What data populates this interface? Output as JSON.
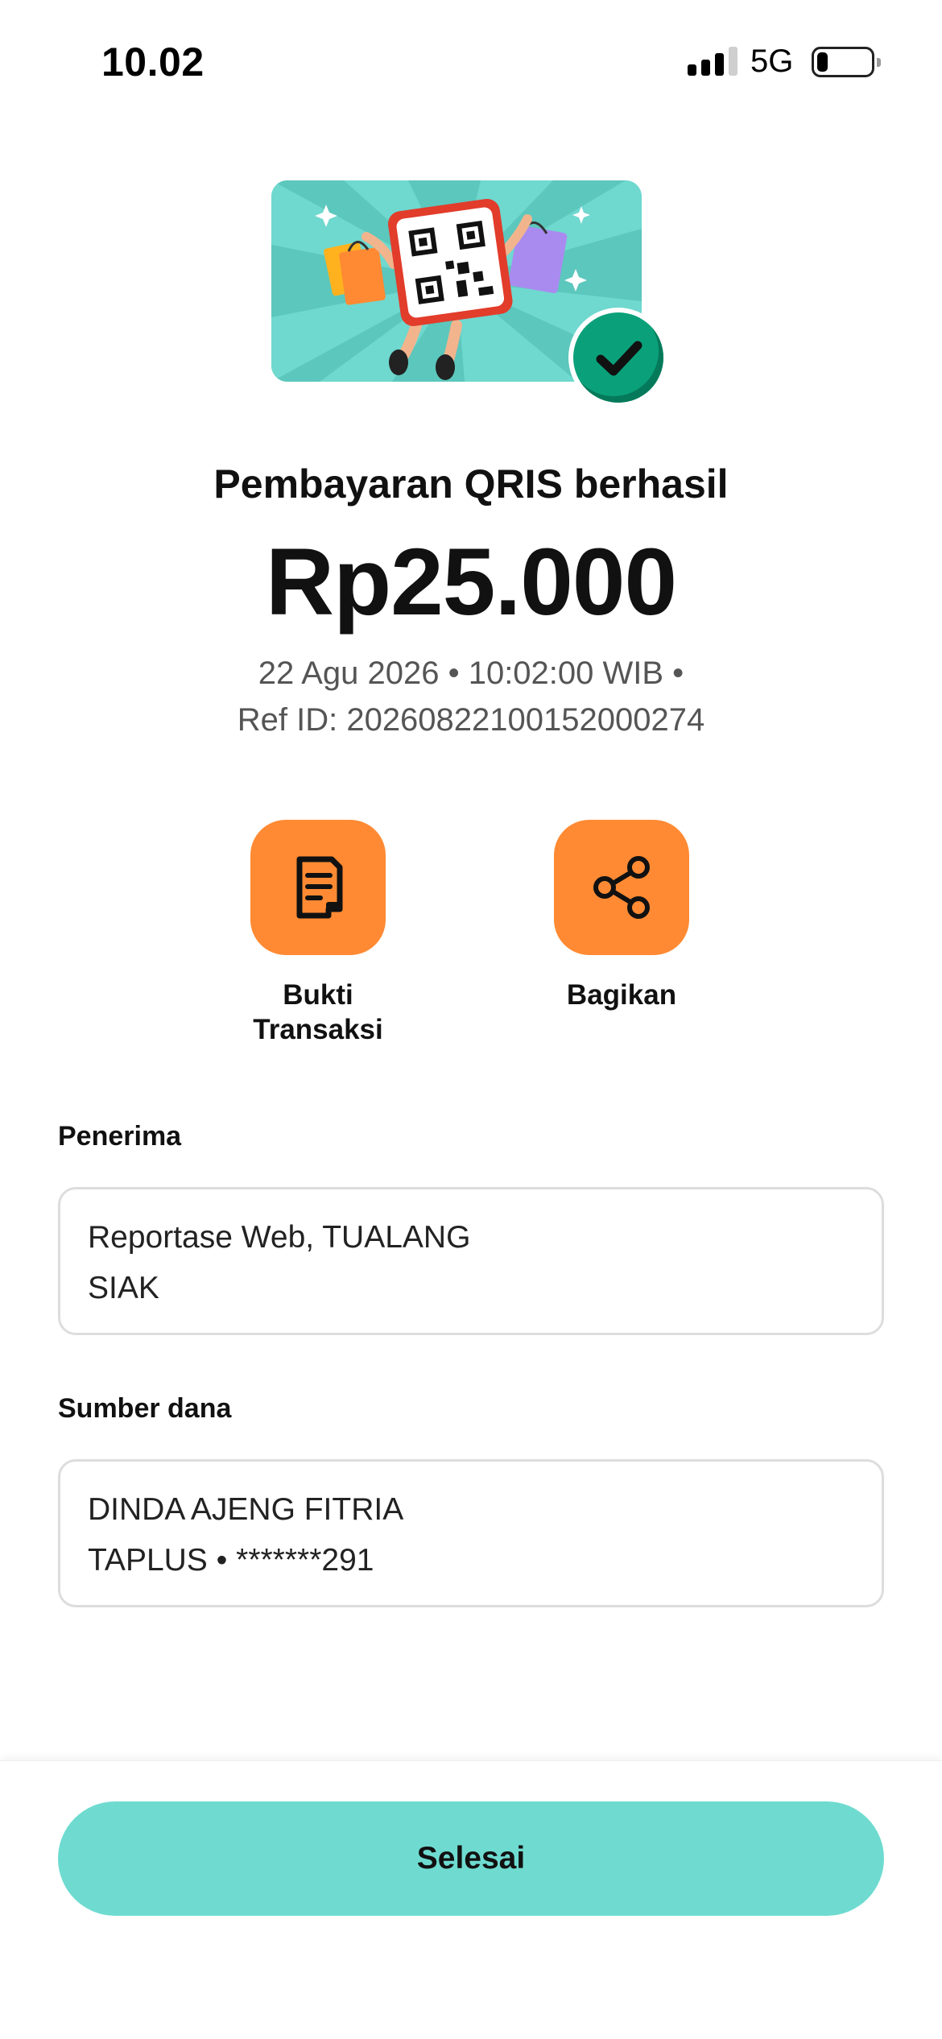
{
  "status_bar": {
    "time": "10.02",
    "network": "5G",
    "signal_bars_active": 3,
    "battery_level": 0.2
  },
  "colors": {
    "accent_orange": "#ff8a33",
    "primary_teal": "#6fdbd0",
    "success_green": "#0aa17a"
  },
  "hero": {
    "illustration": "qris-shopping-illustration",
    "badge_icon": "checkmark-icon"
  },
  "payment": {
    "title": "Pembayaran QRIS berhasil",
    "amount": "Rp25.000",
    "datetime_line": "22 Agu 2026 • 10:02:00 WIB •",
    "ref_line": "Ref ID: 20260822100152000274"
  },
  "actions": [
    {
      "label_line1": "Bukti",
      "label_line2": "Transaksi",
      "icon": "receipt-icon"
    },
    {
      "label_line1": "Bagikan",
      "label_line2": "",
      "icon": "share-icon"
    }
  ],
  "recipient": {
    "label": "Penerima",
    "line1": "Reportase Web, TUALANG",
    "line2": "SIAK"
  },
  "source": {
    "label": "Sumber dana",
    "line1": "DINDA AJENG FITRIA",
    "line2": "TAPLUS • *******291"
  },
  "footer": {
    "done_label": "Selesai"
  }
}
